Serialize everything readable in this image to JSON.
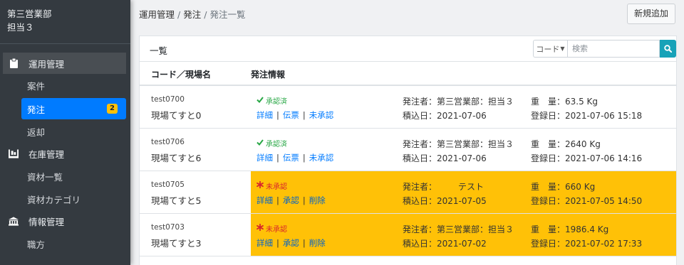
{
  "sidebar": {
    "user_dept": "第三営業部",
    "user_name": "担当３",
    "sections": [
      {
        "label": "運用管理",
        "icon": "clipboard-icon"
      },
      {
        "label": "在庫管理",
        "icon": "pallet-icon"
      },
      {
        "label": "情報管理",
        "icon": "building-icon"
      }
    ],
    "items": [
      {
        "label": "案件"
      },
      {
        "label": "発注",
        "badge": "2"
      },
      {
        "label": "返却"
      },
      {
        "label": "資材一覧"
      },
      {
        "label": "資材カテゴリ"
      },
      {
        "label": "職方"
      }
    ]
  },
  "header": {
    "breadcrumb": [
      "運用管理",
      "発注",
      "発注一覧"
    ],
    "add_button": "新規追加"
  },
  "list": {
    "title": "一覧",
    "filter_select": "コード",
    "search_placeholder": "検索",
    "col_code": "コード／現場名",
    "col_info": "発注情報",
    "rows": [
      {
        "code": "test0700",
        "site": "現場てすと0",
        "status": "承認済",
        "status_type": "approved",
        "links": [
          "詳細",
          "伝票",
          "未承認"
        ],
        "orderer": "発注者：第三営業部：担当３",
        "load_date": "積込日：2021-07-06",
        "weight": "重　量：63.5 Kg",
        "registered": "登録日：2021-07-06 15:18"
      },
      {
        "code": "test0706",
        "site": "現場てすと6",
        "status": "承認済",
        "status_type": "approved",
        "links": [
          "詳細",
          "伝票",
          "未承認"
        ],
        "orderer": "発注者：第三営業部：担当３",
        "load_date": "積込日：2021-07-06",
        "weight": "重　量：2640 Kg",
        "registered": "登録日：2021-07-06 14:16"
      },
      {
        "code": "test0705",
        "site": "現場てすと5",
        "status": "未承認",
        "status_type": "pending",
        "links": [
          "詳細",
          "承認",
          "削除"
        ],
        "orderer": "発注者：　　　テスト",
        "load_date": "積込日：2021-07-05",
        "weight": "重　量：660 Kg",
        "registered": "登録日：2021-07-05 14:50"
      },
      {
        "code": "test0703",
        "site": "現場てすと3",
        "status": "未承認",
        "status_type": "pending",
        "links": [
          "詳細",
          "承認",
          "削除"
        ],
        "orderer": "発注者：第三営業部：担当３",
        "load_date": "積込日：2021-07-02",
        "weight": "重　量：1986.4 Kg",
        "registered": "登録日：2021-07-02 17:33"
      }
    ]
  },
  "colors": {
    "sidebar_bg": "#343a40",
    "active_item": "#007bff",
    "badge": "#ffc107",
    "pending_row": "#ffc107",
    "approved": "#28a745",
    "pending_mark": "#d9262c",
    "search_button": "#17a2b8"
  }
}
